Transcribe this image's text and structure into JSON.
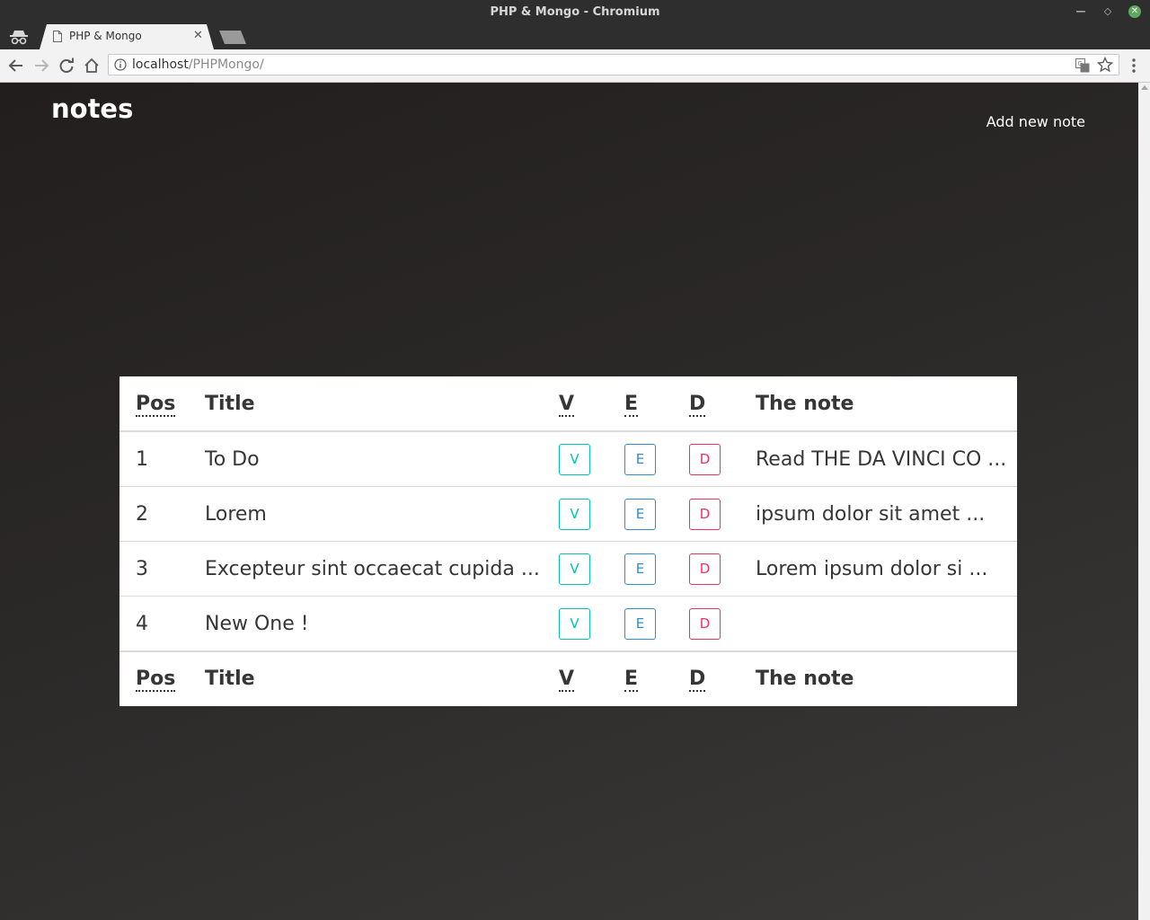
{
  "window": {
    "title": "PHP & Mongo - Chromium",
    "minimize_glyph": "—",
    "maximize_glyph": "◇",
    "close_glyph": "✕"
  },
  "tab": {
    "title": "PHP & Mongo",
    "close_glyph": "✕"
  },
  "address_bar": {
    "host": "localhost",
    "path": "/PHPMongo/"
  },
  "page": {
    "brand": "notes",
    "add_link": "Add new note"
  },
  "table": {
    "headers": {
      "pos": "Pos",
      "title": "Title",
      "v": "V",
      "e": "E",
      "d": "D",
      "note": "The note"
    },
    "rows": [
      {
        "pos": "1",
        "title": "To Do",
        "v": "V",
        "e": "E",
        "d": "D",
        "note": "Read THE DA VINCI CO ..."
      },
      {
        "pos": "2",
        "title": "Lorem",
        "v": "V",
        "e": "E",
        "d": "D",
        "note": "ipsum dolor sit amet ..."
      },
      {
        "pos": "3",
        "title": "Excepteur sint occaecat cupida ...",
        "v": "V",
        "e": "E",
        "d": "D",
        "note": "Lorem ipsum dolor si ..."
      },
      {
        "pos": "4",
        "title": "New One !",
        "v": "V",
        "e": "E",
        "d": "D",
        "note": ""
      }
    ]
  },
  "icons": {
    "incognito": "incognito-icon",
    "tab_doc": "document-icon",
    "back": "back-arrow-icon",
    "forward": "forward-arrow-icon",
    "reload": "reload-icon",
    "home": "home-icon",
    "info": "info-icon",
    "translate": "translate-icon",
    "bookmark": "star-icon",
    "menu": "kebab-menu-icon"
  },
  "colors": {
    "view": "#00c4b4",
    "edit": "#2c8fd6",
    "delete": "#f0305f",
    "page_background": "#2b2928"
  }
}
